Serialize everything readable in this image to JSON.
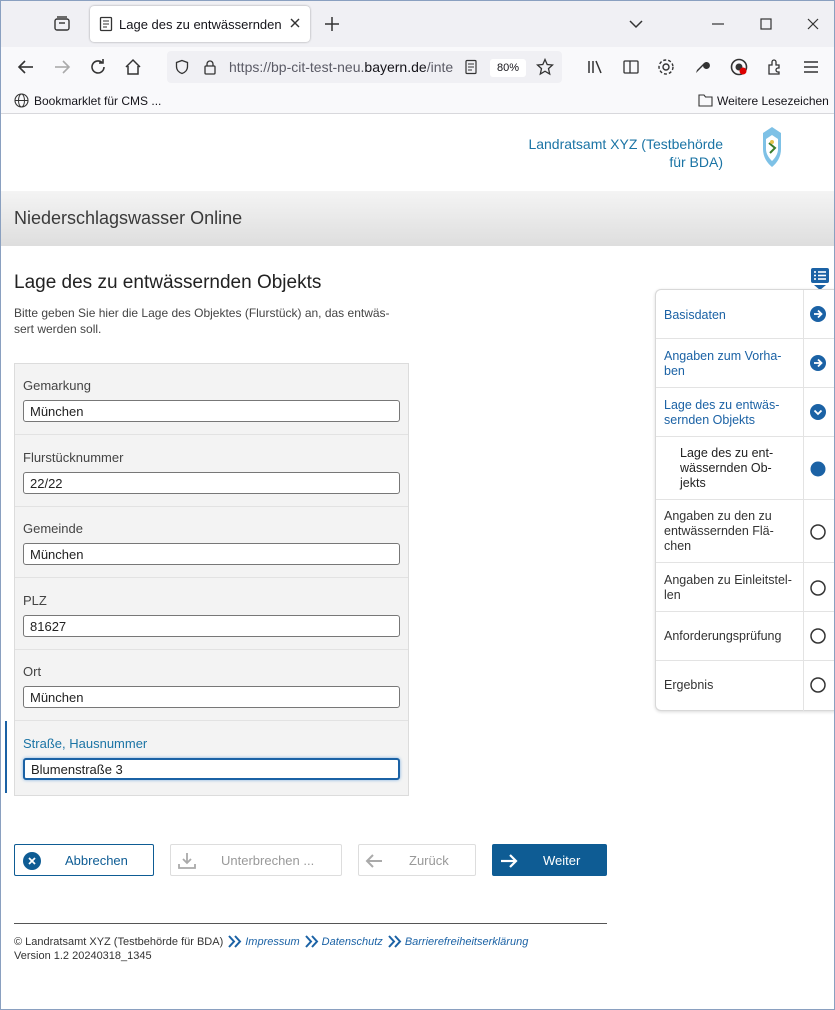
{
  "browser": {
    "tab_title": "Lage des zu entwässernden Objekts",
    "url_prefix": "https://bp-cit-test-neu.",
    "url_domain": "bayern.de",
    "url_suffix": "/inte",
    "zoom": "80%",
    "bookmark_left": "Bookmarklet für CMS ...",
    "bookmark_right": "Weitere Lesezeichen"
  },
  "header": {
    "org_line1": "Landratsamt XYZ (Testbehörde",
    "org_line2": "für BDA)",
    "app_title": "Niederschlagswasser Online"
  },
  "main": {
    "title": "Lage des zu entwässernden Objekts",
    "intro_line1": "Bitte geben Sie hier die Lage des Objektes (Flurstück) an, das entwäs-",
    "intro_line2": "sert werden soll."
  },
  "form": {
    "fields": [
      {
        "label": "Gemarkung",
        "value": "München"
      },
      {
        "label": "Flurstücknummer",
        "value": "22/22"
      },
      {
        "label": "Gemeinde",
        "value": "München"
      },
      {
        "label": "PLZ",
        "value": "81627"
      },
      {
        "label": "Ort",
        "value": "München"
      },
      {
        "label": "Straße, Hausnummer",
        "value": "Blumenstraße 3"
      }
    ]
  },
  "buttons": {
    "cancel": "Abbrechen",
    "pause": "Unterbrechen ...",
    "back": "Zurück",
    "next": "Weiter"
  },
  "footer": {
    "copyright": "© Landratsamt XYZ (Testbehörde für BDA)",
    "links": [
      "Impressum",
      "Datenschutz",
      "Barrierefreiheitserklärung"
    ],
    "version": "Version 1.2 20240318_1345"
  },
  "sidebar": {
    "items": [
      {
        "line1": "Basisdaten",
        "line2": "",
        "line3": "",
        "state": "link"
      },
      {
        "line1": "Angaben zum Vorha-",
        "line2": "ben",
        "line3": "",
        "state": "link"
      },
      {
        "line1": "Lage des zu entwäs-",
        "line2": "sernden Objekts",
        "line3": "",
        "state": "expanded"
      },
      {
        "line1": "Lage des zu ent-",
        "line2": "wässernden Ob-",
        "line3": "jekts",
        "state": "current"
      },
      {
        "line1": "Angaben zu den zu",
        "line2": "entwässernden Flä-",
        "line3": "chen",
        "state": "open"
      },
      {
        "line1": "Angaben zu Einleitstel-",
        "line2": "len",
        "line3": "",
        "state": "open"
      },
      {
        "line1": "Anforderungsprüfung",
        "line2": "",
        "line3": "",
        "state": "open"
      },
      {
        "line1": "Ergebnis",
        "line2": "",
        "line3": "",
        "state": "open"
      }
    ]
  },
  "colors": {
    "accent": "#0e5c94",
    "link": "#1b62a5"
  }
}
